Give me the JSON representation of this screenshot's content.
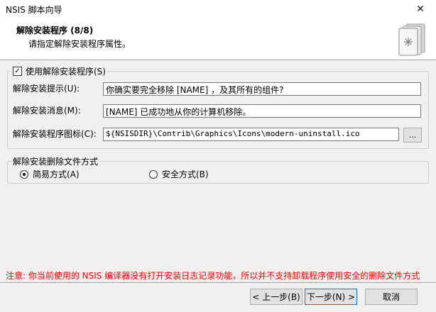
{
  "window": {
    "title": "NSIS 脚本向导",
    "close_glyph": "✕"
  },
  "header": {
    "title": "解除安装程序 (8/8)",
    "subtitle": "请指定解除安装程序属性。",
    "icon": "installer-disk-icon"
  },
  "uninstall_group": {
    "checkbox_label": "使用解除安装程序(S)",
    "checked": true,
    "prompt_label": "解除安装提示(U):",
    "prompt_value": "你确实要完全移除 [NAME] ，及其所有的组件?",
    "message_label": "解除安装消息(M):",
    "message_value": "[NAME] 已成功地从你的计算机移除。",
    "icon_label": "解除安装程序图标(C):",
    "icon_value": "${NSISDIR}\\Contrib\\Graphics\\Icons\\modern-uninstall.ico",
    "browse_label": "..."
  },
  "delete_mode_group": {
    "title": "解除安装删除文件方式",
    "options": [
      {
        "label": "简易方式(A)",
        "selected": true
      },
      {
        "label": "安全方式(B)",
        "selected": false
      }
    ]
  },
  "note": {
    "text": "注意: 你当前使用的 NSIS 编译器没有打开安装日志记录功能，所以并不支持卸载程序使用安全的删除文件方式",
    "color": "#ff0000"
  },
  "buttons": {
    "back": "< 上一步(B)",
    "next": "下一步(N) >",
    "cancel": "取消"
  }
}
